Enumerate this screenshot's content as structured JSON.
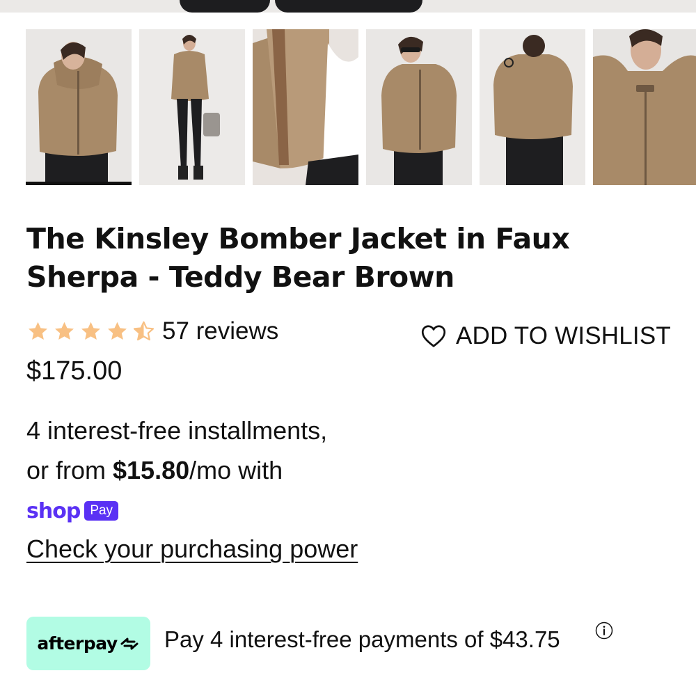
{
  "product": {
    "title": "The Kinsley Bomber Jacket in Faux Sherpa - Teddy Bear Brown",
    "rating": 4.5,
    "reviews_label": "57 reviews",
    "wishlist_label": "ADD TO WISHLIST",
    "price": "$175.00"
  },
  "gallery": {
    "thumbnails": [
      {
        "icon": "front-view-photo",
        "active": true
      },
      {
        "icon": "full-body-photo",
        "active": false
      },
      {
        "icon": "lining-detail-photo",
        "active": false
      },
      {
        "icon": "front-sunglasses-photo",
        "active": false
      },
      {
        "icon": "back-view-photo",
        "active": false
      },
      {
        "icon": "collar-closeup-photo",
        "active": false
      }
    ]
  },
  "installments": {
    "line1": "4 interest-free installments,",
    "line2_prefix": "or from ",
    "monthly_amount": "$15.80",
    "line2_suffix": "/mo with",
    "shop_word": "shop",
    "pay_badge": "Pay",
    "purchasing_link": "Check your purchasing power"
  },
  "afterpay": {
    "logo_text": "afterpay",
    "message": "Pay 4 interest-free payments of $43.75"
  },
  "colors": {
    "star": "#f8c083",
    "shop_pay": "#5a31f4",
    "afterpay_bg": "#b2fce4",
    "jacket": "#a88a68"
  }
}
